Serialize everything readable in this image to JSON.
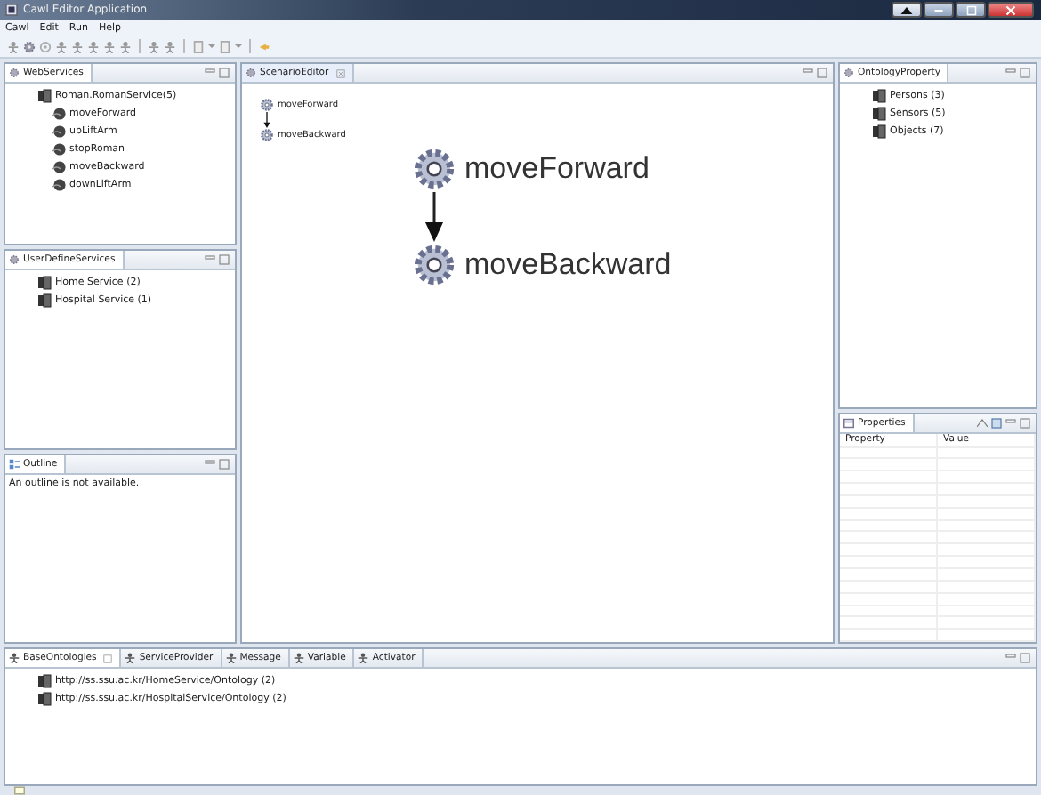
{
  "window": {
    "title": "Cawl Editor Application"
  },
  "menu": [
    "Cawl",
    "Edit",
    "Run",
    "Help"
  ],
  "web_services": {
    "tab": "WebServices",
    "tree": [
      {
        "label": "Roman.RomanService(5)",
        "children": [
          {
            "label": "moveForward"
          },
          {
            "label": "upLiftArm"
          },
          {
            "label": "stopRoman"
          },
          {
            "label": "moveBackward"
          },
          {
            "label": "downLiftArm"
          }
        ]
      }
    ]
  },
  "user_define_services": {
    "tab": "UserDefineServices",
    "tree": [
      {
        "label": "Home Service (2)"
      },
      {
        "label": "Hospital Service (1)"
      }
    ]
  },
  "outline": {
    "tab": "Outline",
    "message": "An outline is not available."
  },
  "scenario_editor": {
    "tab": "ScenarioEditor",
    "overview": [
      "moveForward",
      "moveBackward"
    ],
    "nodes": [
      "moveForward",
      "moveBackward"
    ]
  },
  "ontology_property": {
    "tab": "OntologyProperty",
    "tree": [
      {
        "label": "Persons (3)"
      },
      {
        "label": "Sensors (5)"
      },
      {
        "label": "Objects (7)"
      }
    ]
  },
  "properties": {
    "tab": "Properties",
    "columns": [
      "Property",
      "Value"
    ]
  },
  "bottom_tabs": [
    {
      "label": "BaseOntologies",
      "selected": true
    },
    {
      "label": "ServiceProvider",
      "selected": false
    },
    {
      "label": "Message",
      "selected": false
    },
    {
      "label": "Variable",
      "selected": false
    },
    {
      "label": "Activator",
      "selected": false
    }
  ],
  "base_ontologies": [
    "http://ss.ssu.ac.kr/HomeService/Ontology (2)",
    "http://ss.ssu.ac.kr/HospitalService/Ontology (2)"
  ]
}
